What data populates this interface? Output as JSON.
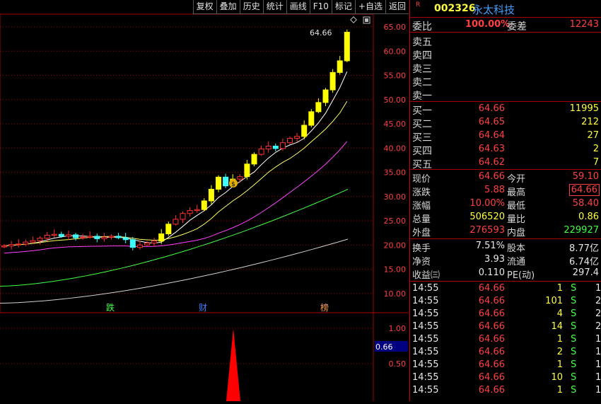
{
  "toolbar": {
    "buttons": [
      "复权",
      "叠加",
      "历史",
      "统计",
      "画线",
      "F10",
      "标记",
      "+自选",
      "返回"
    ]
  },
  "main_chart": {
    "price_labels": [
      "65.00",
      "60.00",
      "55.00",
      "50.00",
      "45.00",
      "40.00",
      "35.00",
      "30.00",
      "25.00",
      "20.00",
      "15.00",
      "10.00"
    ],
    "high_label": "64.66",
    "event_tags": [
      "跌",
      "财",
      "榜"
    ]
  },
  "volume_chart": {
    "axis_labels": [
      "1.00",
      "0.50"
    ],
    "current_value": "0.66"
  },
  "stock": {
    "badge": "R",
    "code": "002326",
    "name": "永太科技"
  },
  "commission": {
    "ratio_label": "委比",
    "ratio": "100.00%",
    "diff_label": "委差",
    "diff": "12243"
  },
  "asks": [
    {
      "label": "卖五"
    },
    {
      "label": "卖四"
    },
    {
      "label": "卖三"
    },
    {
      "label": "卖二"
    },
    {
      "label": "卖一"
    }
  ],
  "bids": [
    {
      "label": "买一",
      "price": "64.66",
      "vol": "11995"
    },
    {
      "label": "买二",
      "price": "64.65",
      "vol": "212"
    },
    {
      "label": "买三",
      "price": "64.64",
      "vol": "27"
    },
    {
      "label": "买四",
      "price": "64.63",
      "vol": "2"
    },
    {
      "label": "买五",
      "price": "64.62",
      "vol": "7"
    }
  ],
  "quote": {
    "now_label": "现价",
    "now": "64.66",
    "open_label": "今开",
    "open": "59.10",
    "chg_label": "涨跌",
    "chg": "5.88",
    "high_label": "最高",
    "high": "64.66",
    "pct_label": "涨幅",
    "pct": "10.00%",
    "low_label": "最低",
    "low": "58.40",
    "vol_label": "总量",
    "vol": "506520",
    "vr_label": "量比",
    "vr": "0.86",
    "outer_label": "外盘",
    "outer": "276593",
    "inner_label": "内盘",
    "inner": "229927"
  },
  "fundamentals": {
    "turnover_label": "换手",
    "turnover": "7.51%",
    "shares_label": "股本",
    "shares": "8.77亿",
    "nav_label": "净资",
    "nav": "3.93",
    "float_label": "流通",
    "float": "6.74亿",
    "eps_label": "收益㈢",
    "eps": "0.110",
    "pe_label": "PE(动)",
    "pe": "297.4"
  },
  "ticks": [
    {
      "time": "14:55",
      "price": "64.66",
      "vol": "1",
      "side": "S",
      "n": "1"
    },
    {
      "time": "14:55",
      "price": "64.66",
      "vol": "101",
      "side": "S",
      "n": "2"
    },
    {
      "time": "14:55",
      "price": "64.66",
      "vol": "4",
      "side": "S",
      "n": "2"
    },
    {
      "time": "14:55",
      "price": "64.66",
      "vol": "14",
      "side": "S",
      "n": "2"
    },
    {
      "time": "14:55",
      "price": "64.66",
      "vol": "1",
      "side": "S",
      "n": "1"
    },
    {
      "time": "14:55",
      "price": "64.66",
      "vol": "2",
      "side": "S",
      "n": "1"
    },
    {
      "time": "14:55",
      "price": "64.66",
      "vol": "1",
      "side": "S",
      "n": "1"
    },
    {
      "time": "14:55",
      "price": "64.66",
      "vol": "10",
      "side": "S",
      "n": "1"
    },
    {
      "time": "14:55",
      "price": "64.66",
      "vol": "1",
      "side": "S",
      "n": "1"
    }
  ],
  "colors": {
    "up": "#ff3030",
    "limit_up": "#ffff00",
    "down": "#40ffff",
    "ma5": "#ffffff",
    "ma10": "#ffff60",
    "ma20": "#ff40ff",
    "ma60": "#40ff40",
    "ma120": "#d0d0d0"
  }
}
